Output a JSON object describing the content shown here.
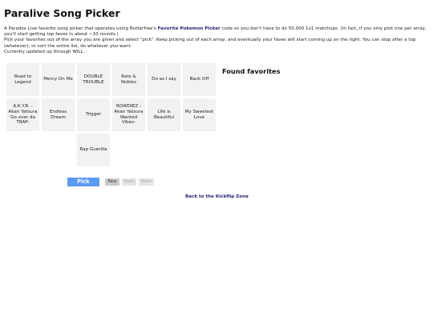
{
  "page": {
    "title": "Paralive Song Picker",
    "intro_pre": "A Paradox Live favorite song picker that operates using Butterfree's ",
    "intro_link": "Favorite Pokemon Picker",
    "intro_post": " code so you don't have to do 50,000 1v1 matchups. (In fact, if you only pick one per array, you'll start getting top faves in about ~10 rounds.)",
    "intro_line2": "Pick your favorites out of the array you are given and select \"pick\". Keep picking out of each array, and eventually your faves will start coming up on the right. You can stop after a top (whatever), or sort the entire list, do whatever you want.",
    "intro_line3": "Currently updated up through WILL."
  },
  "songs": [
    "Road to Legend",
    "Mercy On Me",
    "DOUBLE TROUBLE",
    "Rats & Nobles",
    "Do as I say",
    "Back Off",
    "A.K.Y.R. -Akan Yatsura Go over da TRAP-",
    "Endless Dream",
    "Trigger",
    "ROWDIEZ -Akan Yatsura Wanted Vibes-",
    "Life is Beautiful",
    "My Sweetest Love",
    "Rap Guerilla"
  ],
  "favorites": {
    "title": "Found favorites"
  },
  "controls": {
    "pick": "Pick",
    "pass": "Pass",
    "undo": "Undo",
    "redo": "Redo"
  },
  "footer": {
    "back_link": "Back to the Kickflip Zone"
  }
}
